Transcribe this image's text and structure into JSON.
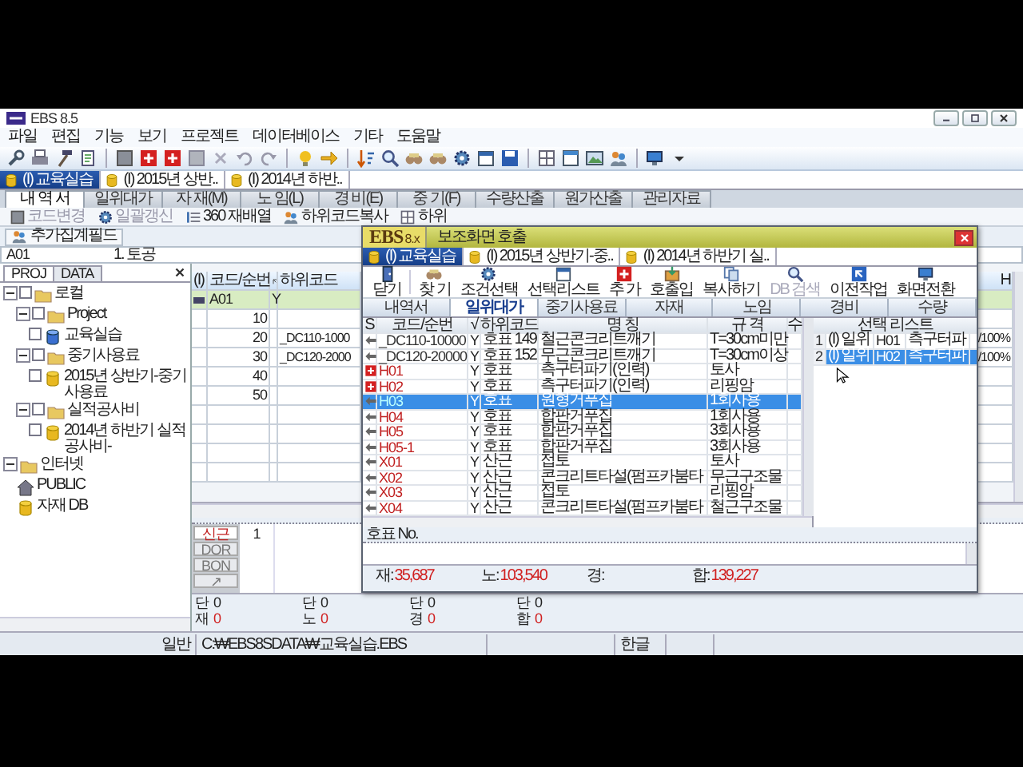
{
  "window": {
    "title": "EBS 8.5"
  },
  "menu": [
    "파일",
    "편집",
    "기능",
    "보기",
    "프로젝트",
    "데이터베이스",
    "기타",
    "도움말"
  ],
  "project_tabs": [
    {
      "label": "(I) 교육실습",
      "selected": true
    },
    {
      "label": "(I) 2015년 상반..",
      "selected": false
    },
    {
      "label": "(I) 2014년 하반..",
      "selected": false
    }
  ],
  "main_tabs": [
    {
      "label": "내 역 서",
      "selected": true
    },
    {
      "label": "일위대가",
      "selected": false
    },
    {
      "label": "자 재(M)",
      "selected": false
    },
    {
      "label": "노 임(L)",
      "selected": false
    },
    {
      "label": "경 비(E)",
      "selected": false
    },
    {
      "label": "중 기(F)",
      "selected": false
    },
    {
      "label": "수량산출",
      "selected": false
    },
    {
      "label": "원가산출",
      "selected": false
    },
    {
      "label": "관리자료",
      "selected": false
    }
  ],
  "actions": [
    {
      "label": "코드변경",
      "disabled": true
    },
    {
      "label": "일괄갱신",
      "disabled": true
    },
    {
      "label": "360 재배열",
      "disabled": false
    },
    {
      "label": "하위코드복사",
      "disabled": false
    },
    {
      "label": "하위",
      "disabled": false
    }
  ],
  "extra_field_button": "추가집계필드",
  "current_item": {
    "code": "A01",
    "name": "1. 토공"
  },
  "side_panel": {
    "tabs": [
      {
        "label": "PROJ",
        "selected": true
      },
      {
        "label": "DATA",
        "selected": false
      }
    ],
    "tree": [
      {
        "label": "로컬",
        "kind": "folder",
        "expanded": true,
        "checked": false,
        "children": [
          {
            "label": "Project",
            "kind": "folder",
            "expanded": true,
            "checked": false,
            "children": [
              {
                "label": "교육실습",
                "kind": "db-blue",
                "checked": false
              }
            ]
          },
          {
            "label": "중기사용료",
            "kind": "folder",
            "expanded": true,
            "checked": false,
            "children": [
              {
                "label": "2015년 상반기-중기사용료",
                "kind": "db",
                "checked": false
              }
            ]
          },
          {
            "label": "실적공사비",
            "kind": "folder",
            "expanded": true,
            "checked": false,
            "children": [
              {
                "label": "2014년 하반기 실적공사비-",
                "kind": "db",
                "checked": false
              }
            ]
          }
        ]
      },
      {
        "label": "인터넷",
        "kind": "folder",
        "expanded": true,
        "children": [
          {
            "label": "PUBLIC",
            "kind": "house"
          },
          {
            "label": "자재 DB",
            "kind": "db"
          }
        ]
      }
    ]
  },
  "grid": {
    "columns": [
      "(I)",
      "코드/순번",
      "하위코드",
      "H"
    ],
    "rows": [
      {
        "kind": "heading",
        "code": "A01",
        "flag": "Y",
        "selected": true
      },
      {
        "kind": "line",
        "code": "10",
        "selected": false
      },
      {
        "kind": "line",
        "code": "20",
        "sub_code": "_DC110-1000",
        "ratio": "/100%",
        "selected": false
      },
      {
        "kind": "line",
        "code": "30",
        "sub_code": "_DC120-2000",
        "ratio": "/100%",
        "selected": false
      },
      {
        "kind": "line",
        "code": "40",
        "selected": false
      },
      {
        "kind": "line",
        "code": "50",
        "selected": false
      }
    ]
  },
  "editor": {
    "side_tabs": [
      {
        "label": "신근",
        "selected": true
      },
      {
        "label": "DOR",
        "selected": false
      },
      {
        "label": "BON",
        "selected": false
      },
      {
        "label": "↗",
        "selected": false
      }
    ],
    "line_number": "1"
  },
  "summary": [
    {
      "top_label": "단",
      "top_value": "0",
      "label": "재",
      "value": "0"
    },
    {
      "top_label": "단",
      "top_value": "0",
      "label": "노",
      "value": "0"
    },
    {
      "top_label": "단",
      "top_value": "0",
      "label": "경",
      "value": "0"
    },
    {
      "top_label": "단",
      "top_value": "0",
      "label": "합",
      "value": "0"
    }
  ],
  "status_bar": [
    "일반",
    "C:₩EBS8SDATA₩교육실습.EBS",
    "한글"
  ],
  "dialog": {
    "logo": "EBS",
    "logo_version": "8.x",
    "title": "보조화면 호출",
    "project_tabs": [
      {
        "label": "(I) 교육실습",
        "selected": true
      },
      {
        "label": "(I) 2015년 상반기-중..",
        "selected": false
      },
      {
        "label": "(I) 2014년 하반기 실..",
        "selected": false
      }
    ],
    "tools": [
      {
        "label": "닫기",
        "disabled": false
      },
      {
        "label": "찾 기",
        "disabled": false
      },
      {
        "label": "조건선택",
        "disabled": false
      },
      {
        "label": "선택리스트",
        "disabled": false
      },
      {
        "label": "추 가",
        "disabled": false
      },
      {
        "label": "호출입",
        "disabled": false
      },
      {
        "label": "복사하기",
        "disabled": false
      },
      {
        "label": "DB 검색",
        "disabled": true
      },
      {
        "label": "이전작업",
        "disabled": false
      },
      {
        "label": "화면전환",
        "disabled": false
      }
    ],
    "tabs": [
      {
        "label": "내역서",
        "selected": false
      },
      {
        "label": "일위대가",
        "selected": true
      },
      {
        "label": "중기사용료",
        "selected": false
      },
      {
        "label": "자재",
        "selected": false
      },
      {
        "label": "노임",
        "selected": false
      },
      {
        "label": "경비",
        "selected": false
      },
      {
        "label": "수량",
        "selected": false
      }
    ],
    "columns": [
      "S",
      "코드/순번",
      "√",
      "하위코드",
      "명 칭",
      "규 격",
      "수"
    ],
    "rows": [
      {
        "added": false,
        "kind": "group",
        "code": "_DC110-10000",
        "flag": "Y",
        "sub_code": "호표 149",
        "name": "철근콘크리트깨기",
        "spec": "T=30cm미만",
        "selected": false
      },
      {
        "added": false,
        "kind": "group",
        "code": "_DC120-20000",
        "flag": "Y",
        "sub_code": "호표 152",
        "name": "무근콘크리트깨기",
        "spec": "T=30cm이상",
        "selected": false
      },
      {
        "added": true,
        "kind": "item",
        "code": "H01",
        "flag": "Y",
        "sub_code": "호표",
        "name": "측구터파기(인력)",
        "spec": "토사",
        "selected": false
      },
      {
        "added": true,
        "kind": "item",
        "code": "H02",
        "flag": "Y",
        "sub_code": "호표",
        "name": "측구터파기(인력)",
        "spec": "리핑암",
        "selected": false
      },
      {
        "added": false,
        "kind": "item",
        "code": "H03",
        "flag": "Y",
        "sub_code": "호표",
        "name": "원형거푸집",
        "spec": "1회사용",
        "selected": true
      },
      {
        "added": false,
        "kind": "item",
        "code": "H04",
        "flag": "Y",
        "sub_code": "호표",
        "name": "합판거푸집",
        "spec": "1회사용",
        "selected": false
      },
      {
        "added": false,
        "kind": "item",
        "code": "H05",
        "flag": "Y",
        "sub_code": "호표",
        "name": "합판거푸집",
        "spec": "3회사용",
        "selected": false
      },
      {
        "added": false,
        "kind": "item",
        "code": "H05-1",
        "flag": "Y",
        "sub_code": "호표",
        "name": "합판거푸집",
        "spec": "3회사용",
        "selected": false
      },
      {
        "added": false,
        "kind": "item",
        "code": "X01",
        "flag": "Y",
        "sub_code": "산근",
        "name": "접토",
        "spec": "토사",
        "selected": false
      },
      {
        "added": false,
        "kind": "item",
        "code": "X02",
        "flag": "Y",
        "sub_code": "산근",
        "name": "콘크리트타설(펌프카붐타",
        "spec": "무근구조물",
        "selected": false
      },
      {
        "added": false,
        "kind": "item",
        "code": "X03",
        "flag": "Y",
        "sub_code": "산근",
        "name": "접토",
        "spec": "리핑암",
        "selected": false
      },
      {
        "added": false,
        "kind": "item",
        "code": "X04",
        "flag": "Y",
        "sub_code": "산근",
        "name": "콘크리트타설(펌프카붐타",
        "spec": "철근구조물",
        "selected": false
      }
    ],
    "selection": {
      "title": "선택 리스트",
      "rows": [
        {
          "index": "1",
          "type": "(I) 일위",
          "code": "H01",
          "name": "측구터파",
          "selected": false
        },
        {
          "index": "2",
          "type": "(I) 일위",
          "code": "H02",
          "name": "측구터파",
          "selected": true
        }
      ]
    },
    "code_label": "호표 No.",
    "totals": [
      {
        "label": "재:",
        "value": "35,687"
      },
      {
        "label": "노:",
        "value": "103,540"
      },
      {
        "label": "경:"
      },
      {
        "label": "합:",
        "value": "139,227"
      }
    ]
  }
}
